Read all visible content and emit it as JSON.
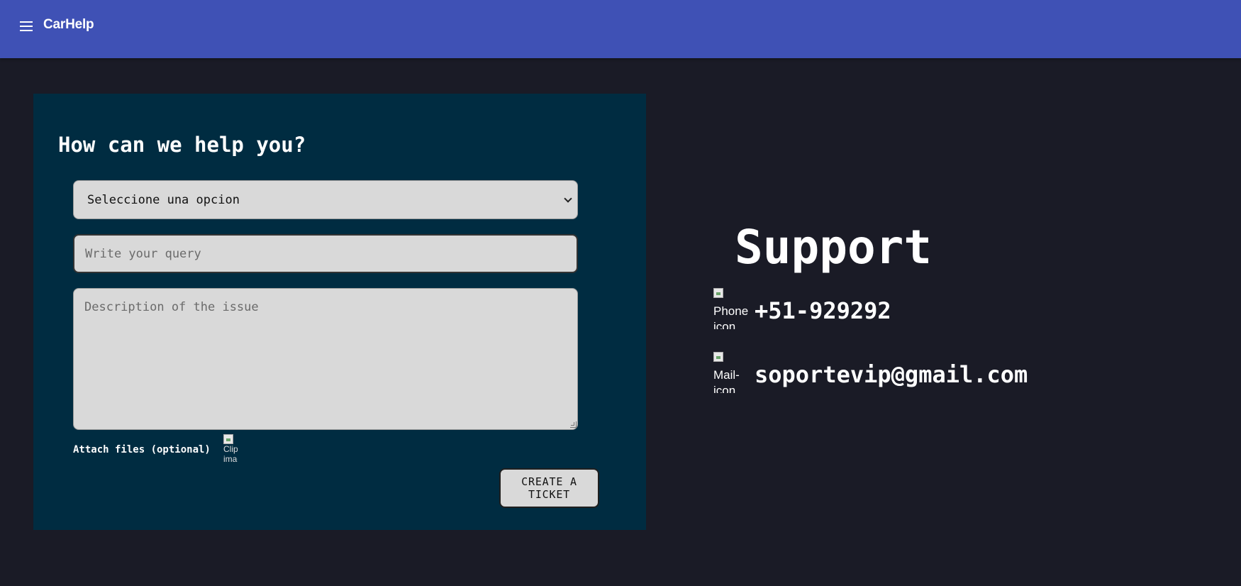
{
  "app": {
    "brand": "CarHelp"
  },
  "form": {
    "title": "How can we help you?",
    "select": {
      "selected": "Seleccione una opcion"
    },
    "query": {
      "placeholder": "Write your query",
      "value": ""
    },
    "description": {
      "placeholder": "Description of the issue",
      "value": ""
    },
    "attach_label": "Attach files (optional)",
    "clip_image_alt": "Clip image",
    "submit_label": "CREATE A TICKET"
  },
  "support": {
    "title": "Support",
    "phone": {
      "icon": "phone-icon",
      "icon_alt": "Phone icon",
      "value": "+51-929292"
    },
    "mail": {
      "icon": "mail-icon",
      "icon_alt": "Mail-icon",
      "value": "soportevip@gmail.com"
    }
  },
  "colors": {
    "toolbar": "#3f51b5",
    "background": "#1a1b26",
    "card": "#002c41",
    "field": "#d9d9d9"
  }
}
